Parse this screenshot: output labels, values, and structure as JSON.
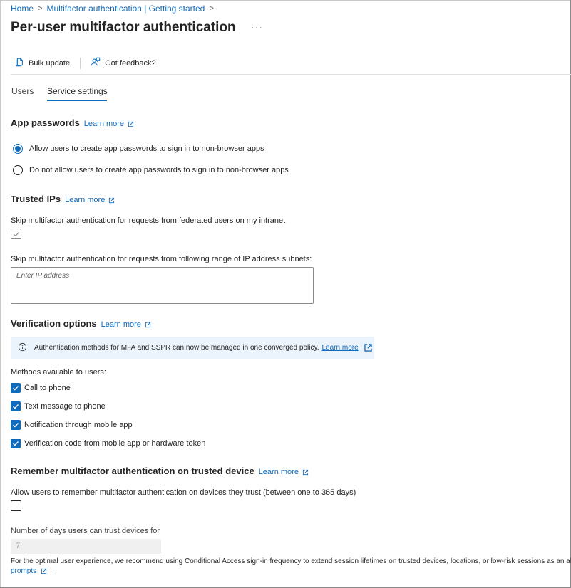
{
  "breadcrumb": {
    "home": "Home",
    "parent": "Multifactor authentication | Getting started",
    "sep1": ">",
    "sep2": ">"
  },
  "page": {
    "title": "Per-user multifactor authentication",
    "more": "···"
  },
  "toolbar": {
    "bulk_update": "Bulk update",
    "feedback": "Got feedback?"
  },
  "tabs": [
    {
      "label": "Users",
      "selected": false
    },
    {
      "label": "Service settings",
      "selected": true
    }
  ],
  "app_passwords": {
    "heading": "App passwords",
    "learn_more": "Learn more",
    "options": [
      {
        "label": "Allow users to create app passwords to sign in to non-browser apps",
        "selected": true
      },
      {
        "label": "Do not allow users to create app passwords to sign in to non-browser apps",
        "selected": false
      }
    ]
  },
  "trusted_ips": {
    "heading": "Trusted IPs",
    "learn_more": "Learn more",
    "skip_federated_label": "Skip multifactor authentication for requests from federated users on my intranet",
    "skip_federated_checked": true,
    "subnets_label": "Skip multifactor authentication for requests from following range of IP address subnets:",
    "ip_placeholder": "Enter IP address"
  },
  "verification": {
    "heading": "Verification options",
    "learn_more": "Learn more",
    "info_text": "Authentication methods for MFA and SSPR can now be managed in one converged policy.",
    "info_link": "Learn more",
    "methods_label": "Methods available to users:",
    "methods": [
      {
        "label": "Call to phone",
        "checked": true
      },
      {
        "label": "Text message to phone",
        "checked": true
      },
      {
        "label": "Notification through mobile app",
        "checked": true
      },
      {
        "label": "Verification code from mobile app or hardware token",
        "checked": true
      }
    ]
  },
  "remember": {
    "heading": "Remember multifactor authentication on trusted device",
    "learn_more": "Learn more",
    "allow_label": "Allow users to remember multifactor authentication on devices they trust (between one to 365 days)",
    "allow_checked": false,
    "days_label": "Number of days users can trust devices for",
    "days_value": "7",
    "footer_text": "For the optimal user experience, we recommend using Conditional Access sign-in frequency to extend session lifetimes on trusted devices, locations, or low-risk sessions as an alte",
    "footer_link": "prompts",
    "footer_end": "."
  },
  "colors": {
    "accent": "#0f6cbd",
    "info_bg": "#ebf3fc"
  }
}
